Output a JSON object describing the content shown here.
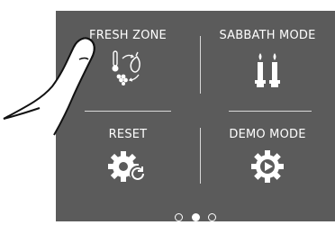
{
  "menu": {
    "items": [
      {
        "label": "FRESH ZONE",
        "icon": "fresh-zone-icon"
      },
      {
        "label": "SABBATH MODE",
        "icon": "candles-icon"
      },
      {
        "label": "RESET",
        "icon": "gear-reset-icon"
      },
      {
        "label": "DEMO MODE",
        "icon": "gear-play-icon"
      }
    ]
  },
  "pagination": {
    "pages": 3,
    "current": 2
  },
  "colors": {
    "panel": "#5b5b5b",
    "text": "#ffffff",
    "divider": "#d8d8d8"
  }
}
